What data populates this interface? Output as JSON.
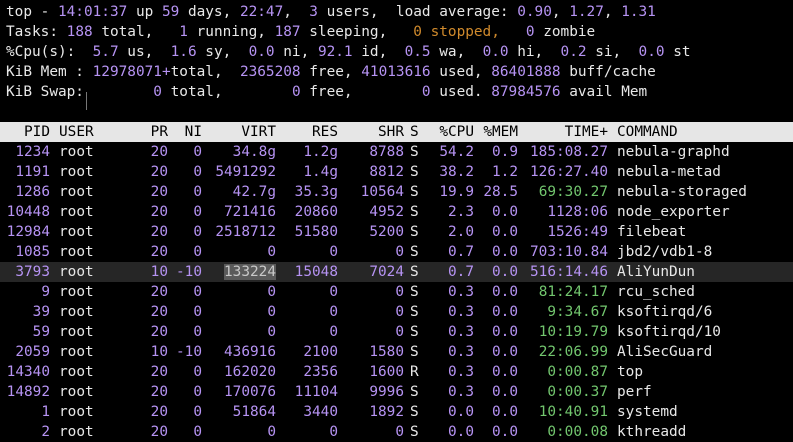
{
  "summary": {
    "top_line": [
      {
        "t": "top - ",
        "c": ""
      },
      {
        "t": "14:01:37",
        "c": "hl"
      },
      {
        "t": " up ",
        "c": ""
      },
      {
        "t": "59",
        "c": "hl"
      },
      {
        "t": " days, ",
        "c": ""
      },
      {
        "t": "22:47",
        "c": "hl"
      },
      {
        "t": ",  ",
        "c": ""
      },
      {
        "t": "3",
        "c": "hl"
      },
      {
        "t": " users,  load average: ",
        "c": ""
      },
      {
        "t": "0.90",
        "c": "hl"
      },
      {
        "t": ", ",
        "c": ""
      },
      {
        "t": "1.27",
        "c": "hl"
      },
      {
        "t": ", ",
        "c": ""
      },
      {
        "t": "1.31",
        "c": "hl"
      }
    ],
    "tasks_line": [
      {
        "t": "Tasks: ",
        "c": ""
      },
      {
        "t": "188",
        "c": "hl"
      },
      {
        "t": " total,   ",
        "c": ""
      },
      {
        "t": "1",
        "c": "hl"
      },
      {
        "t": " running, ",
        "c": ""
      },
      {
        "t": "187",
        "c": "hl"
      },
      {
        "t": " sleeping,   ",
        "c": ""
      },
      {
        "t": "0 stopped,",
        "c": "orange"
      },
      {
        "t": "   ",
        "c": ""
      },
      {
        "t": "0",
        "c": "hl"
      },
      {
        "t": " zombie",
        "c": ""
      }
    ],
    "cpu_line": [
      {
        "t": "%Cpu(s):  ",
        "c": ""
      },
      {
        "t": "5.7",
        "c": "hl"
      },
      {
        "t": " us,  ",
        "c": ""
      },
      {
        "t": "1.6",
        "c": "hl"
      },
      {
        "t": " sy,  ",
        "c": ""
      },
      {
        "t": "0.0",
        "c": "hl"
      },
      {
        "t": " ni, ",
        "c": ""
      },
      {
        "t": "92.1",
        "c": "hl"
      },
      {
        "t": " id,  ",
        "c": ""
      },
      {
        "t": "0.5",
        "c": "hl"
      },
      {
        "t": " wa,  ",
        "c": ""
      },
      {
        "t": "0.0",
        "c": "hl"
      },
      {
        "t": " hi,  ",
        "c": ""
      },
      {
        "t": "0.2",
        "c": "hl"
      },
      {
        "t": " si,  ",
        "c": ""
      },
      {
        "t": "0.0",
        "c": "hl"
      },
      {
        "t": " st",
        "c": ""
      }
    ],
    "mem_line": [
      {
        "t": "KiB Mem : ",
        "c": ""
      },
      {
        "t": "12978071+",
        "c": "hl"
      },
      {
        "t": "total,  ",
        "c": ""
      },
      {
        "t": "2365208",
        "c": "hl"
      },
      {
        "t": " free, ",
        "c": ""
      },
      {
        "t": "41013616",
        "c": "hl"
      },
      {
        "t": " used, ",
        "c": ""
      },
      {
        "t": "86401888",
        "c": "hl"
      },
      {
        "t": " buff/cache",
        "c": ""
      }
    ],
    "swap_line": [
      {
        "t": "KiB Swap:        ",
        "c": ""
      },
      {
        "t": "0",
        "c": "hl"
      },
      {
        "t": " total,        ",
        "c": ""
      },
      {
        "t": "0",
        "c": "hl"
      },
      {
        "t": " free,        ",
        "c": ""
      },
      {
        "t": "0",
        "c": "hl"
      },
      {
        "t": " used. ",
        "c": ""
      },
      {
        "t": "87984576",
        "c": "hl"
      },
      {
        "t": " avail Mem",
        "c": ""
      }
    ]
  },
  "columns": {
    "pid": "PID",
    "user": "USER",
    "pr": "PR",
    "ni": "NI",
    "virt": "VIRT",
    "res": "RES",
    "shr": "SHR",
    "s": "S",
    "cpu": "%CPU",
    "mem": "%MEM",
    "time": "TIME+",
    "cmd": "COMMAND"
  },
  "processes": [
    {
      "pid": "1234",
      "user": "root",
      "pr": "20",
      "ni": "0",
      "virt": "34.8g",
      "res": "1.2g",
      "shr": "8788",
      "s": "S",
      "cpu": "54.2",
      "mem": "0.9",
      "time_a": "185",
      "time_b": ":08.27",
      "cmd": "nebula-graphd"
    },
    {
      "pid": "1191",
      "user": "root",
      "pr": "20",
      "ni": "0",
      "virt": "5491292",
      "res": "1.4g",
      "shr": "8812",
      "s": "S",
      "cpu": "38.2",
      "mem": "1.2",
      "time_a": "126",
      "time_b": ":27.40",
      "cmd": "nebula-metad"
    },
    {
      "pid": "1286",
      "user": "root",
      "pr": "20",
      "ni": "0",
      "virt": "42.7g",
      "res": "35.3g",
      "shr": "10564",
      "s": "S",
      "cpu": "19.9",
      "mem": "28.5",
      "time_a": "69",
      "time_b": ":30.27",
      "time_green": true,
      "cmd": "nebula-storaged"
    },
    {
      "pid": "10448",
      "user": "root",
      "pr": "20",
      "ni": "0",
      "virt": "721416",
      "res": "20860",
      "shr": "4952",
      "s": "S",
      "cpu": "2.3",
      "mem": "0.0",
      "time_a": "1128",
      "time_b": ":06",
      "cmd": "node_exporter"
    },
    {
      "pid": "12984",
      "user": "root",
      "pr": "20",
      "ni": "0",
      "virt": "2518712",
      "res": "51580",
      "shr": "5200",
      "s": "S",
      "cpu": "2.0",
      "mem": "0.0",
      "time_a": "1526",
      "time_b": ":49",
      "cmd": "filebeat"
    },
    {
      "pid": "1085",
      "user": "root",
      "pr": "20",
      "ni": "0",
      "virt": "0",
      "res": "0",
      "shr": "0",
      "s": "S",
      "cpu": "0.7",
      "mem": "0.0",
      "time_a": "703",
      "time_b": ":10.84",
      "cmd": "jbd2/vdb1-8"
    },
    {
      "pid": "3793",
      "user": "root",
      "pr": "10",
      "ni": "-10",
      "virt": "133224",
      "res": "15048",
      "shr": "7024",
      "s": "S",
      "cpu": "0.7",
      "mem": "0.0",
      "time_a": "516",
      "time_b": ":14.46",
      "cmd": "AliYunDun",
      "selected": true
    },
    {
      "pid": "9",
      "user": "root",
      "pr": "20",
      "ni": "0",
      "virt": "0",
      "res": "0",
      "shr": "0",
      "s": "S",
      "cpu": "0.3",
      "mem": "0.0",
      "time_a": "81",
      "time_b": ":24.17",
      "time_green": true,
      "cmd": "rcu_sched"
    },
    {
      "pid": "39",
      "user": "root",
      "pr": "20",
      "ni": "0",
      "virt": "0",
      "res": "0",
      "shr": "0",
      "s": "S",
      "cpu": "0.3",
      "mem": "0.0",
      "time_a": "9",
      "time_b": ":34.67",
      "time_green": true,
      "cmd": "ksoftirqd/6"
    },
    {
      "pid": "59",
      "user": "root",
      "pr": "20",
      "ni": "0",
      "virt": "0",
      "res": "0",
      "shr": "0",
      "s": "S",
      "cpu": "0.3",
      "mem": "0.0",
      "time_a": "10",
      "time_b": ":19.79",
      "time_green": true,
      "cmd": "ksoftirqd/10"
    },
    {
      "pid": "2059",
      "user": "root",
      "pr": "10",
      "ni": "-10",
      "virt": "436916",
      "res": "2100",
      "shr": "1580",
      "s": "S",
      "cpu": "0.3",
      "mem": "0.0",
      "time_a": "22",
      "time_b": ":06.99",
      "time_green": true,
      "cmd": "AliSecGuard"
    },
    {
      "pid": "14340",
      "user": "root",
      "pr": "20",
      "ni": "0",
      "virt": "162020",
      "res": "2356",
      "shr": "1600",
      "s": "R",
      "cpu": "0.3",
      "mem": "0.0",
      "time_a": "0",
      "time_b": ":00.87",
      "time_green": true,
      "cmd": "top"
    },
    {
      "pid": "14892",
      "user": "root",
      "pr": "20",
      "ni": "0",
      "virt": "170076",
      "res": "11104",
      "shr": "9996",
      "s": "S",
      "cpu": "0.3",
      "mem": "0.0",
      "time_a": "0",
      "time_b": ":00.37",
      "time_green": true,
      "cmd": "perf"
    },
    {
      "pid": "1",
      "user": "root",
      "pr": "20",
      "ni": "0",
      "virt": "51864",
      "res": "3440",
      "shr": "1892",
      "s": "S",
      "cpu": "0.0",
      "mem": "0.0",
      "time_a": "10",
      "time_b": ":40.91",
      "time_green": true,
      "cmd": "systemd"
    },
    {
      "pid": "2",
      "user": "root",
      "pr": "20",
      "ni": "0",
      "virt": "0",
      "res": "0",
      "shr": "0",
      "s": "S",
      "cpu": "0.0",
      "mem": "0.0",
      "time_a": "0",
      "time_b": ":00.08",
      "time_green": true,
      "cmd": "kthreadd"
    }
  ],
  "colors": {
    "value": "#b693f3",
    "warn": "#d08a2c",
    "time": "#72c66e",
    "header_bg": "#e6e6e6",
    "bg": "#000000",
    "fg": "#e8e8e8"
  }
}
